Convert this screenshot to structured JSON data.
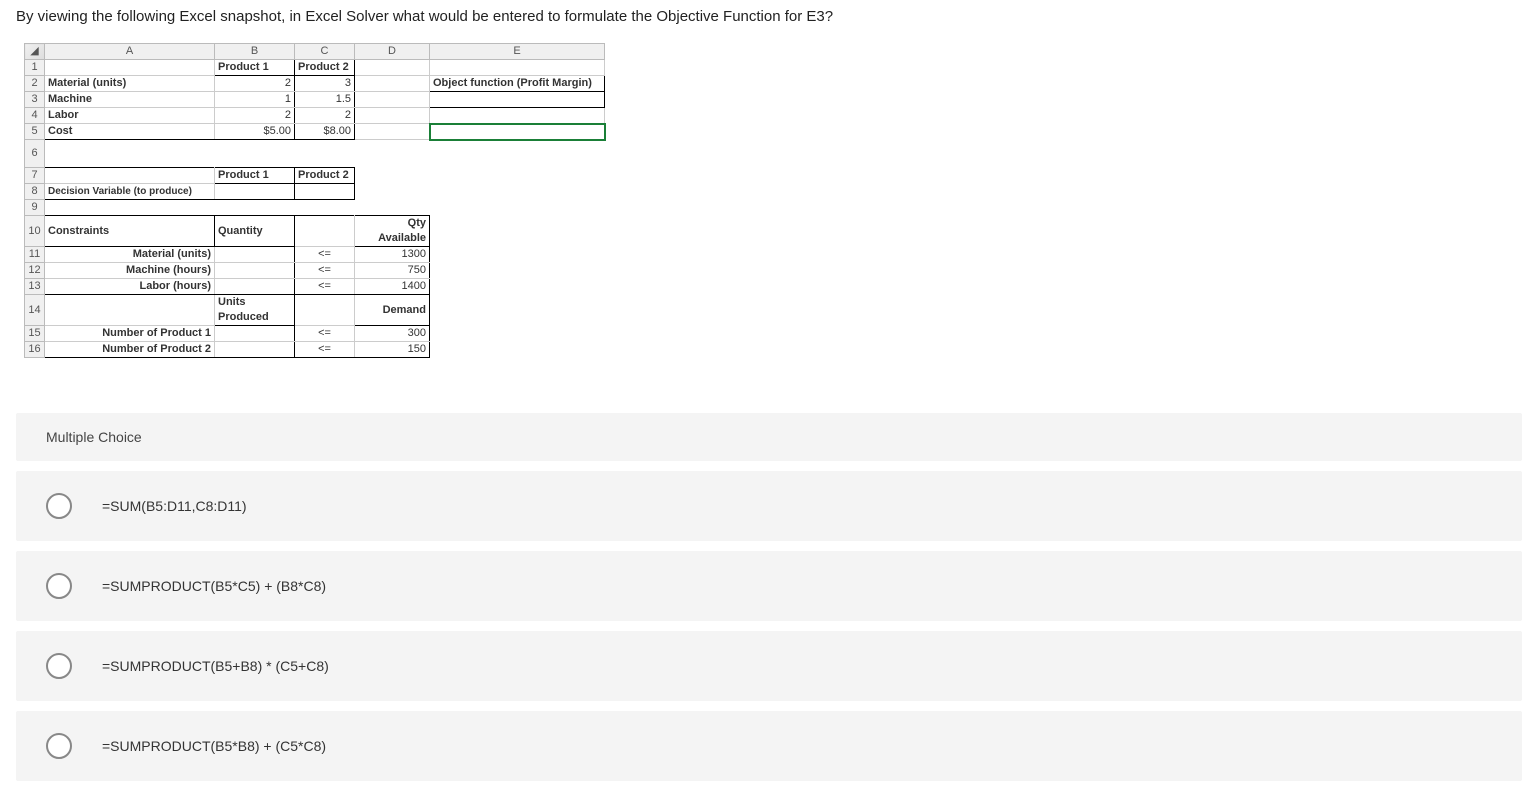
{
  "question": "By viewing the following Excel snapshot, in Excel Solver what would be entered to formulate the Objective Function for E3?",
  "excel": {
    "cols": [
      "A",
      "B",
      "C",
      "D",
      "E"
    ],
    "r1": {
      "B": "Product 1",
      "C": "Product 2"
    },
    "r2": {
      "A": "Material (units)",
      "B": "2",
      "C": "3",
      "E": "Object function (Profit Margin)"
    },
    "r3": {
      "A": "Machine",
      "B": "1",
      "C": "1.5"
    },
    "r4": {
      "A": "Labor",
      "B": "2",
      "C": "2"
    },
    "r5": {
      "A": "Cost",
      "B": "$5.00",
      "C": "$8.00"
    },
    "r7": {
      "B": "Product 1",
      "C": "Product 2"
    },
    "r8": {
      "A": "Decision Variable (to produce)"
    },
    "r10": {
      "A": "Constraints",
      "B": "Quantity",
      "D": "Qty Available"
    },
    "r11": {
      "A": "Material (units)",
      "C": "<=",
      "D": "1300"
    },
    "r12": {
      "A": "Machine (hours)",
      "C": "<=",
      "D": "750"
    },
    "r13": {
      "A": "Labor (hours)",
      "C": "<=",
      "D": "1400"
    },
    "r14": {
      "B": "Units Produced",
      "D": "Demand"
    },
    "r15": {
      "A": "Number of Product 1",
      "C": "<=",
      "D": "300"
    },
    "r16": {
      "A": "Number of Product 2",
      "C": "<=",
      "D": "150"
    }
  },
  "mc": {
    "header": "Multiple Choice",
    "options": [
      "=SUM(B5:D11,C8:D11)",
      "=SUMPRODUCT(B5*C5) + (B8*C8)",
      "=SUMPRODUCT(B5+B8) * (C5+C8)",
      "=SUMPRODUCT(B5*B8) + (C5*C8)"
    ]
  }
}
